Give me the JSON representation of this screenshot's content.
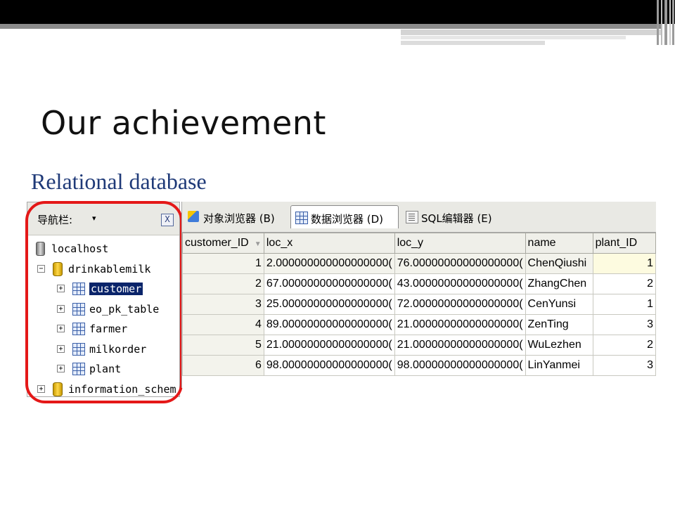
{
  "slide": {
    "title": "Our achievement",
    "subtitle": "Relational database"
  },
  "nav_panel": {
    "header_label": "导航栏:",
    "dropdown_glyph": "▾",
    "close_glyph": "X",
    "tree": [
      {
        "label": "localhost",
        "level": 0,
        "icon": "server-icon",
        "expander": ""
      },
      {
        "label": "drinkablemilk",
        "level": 1,
        "icon": "database-icon",
        "expander": "−"
      },
      {
        "label": "customer",
        "level": 2,
        "icon": "table-icon",
        "expander": "+",
        "selected": true
      },
      {
        "label": "eo_pk_table",
        "level": 2,
        "icon": "table-icon",
        "expander": "+"
      },
      {
        "label": "farmer",
        "level": 2,
        "icon": "table-icon",
        "expander": "+"
      },
      {
        "label": "milkorder",
        "level": 2,
        "icon": "table-icon",
        "expander": "+"
      },
      {
        "label": "plant",
        "level": 2,
        "icon": "table-icon",
        "expander": "+"
      },
      {
        "label": "information_schem",
        "level": 1,
        "icon": "database-icon",
        "expander": "+"
      }
    ]
  },
  "browser": {
    "tabs": [
      {
        "label": "对象浏览器 (B)",
        "icon": "object-browser-icon",
        "active": false
      },
      {
        "label": "数据浏览器 (D)",
        "icon": "data-browser-icon",
        "active": true
      },
      {
        "label": "SQL编辑器 (E)",
        "icon": "sql-editor-icon",
        "active": false
      }
    ],
    "columns": [
      "customer_ID",
      "loc_x",
      "loc_y",
      "name",
      "plant_ID"
    ],
    "sort_glyph": "▼",
    "rows": [
      [
        "1",
        "2.000000000000000000(",
        "76.00000000000000000(",
        "ChenQiushi",
        "1"
      ],
      [
        "2",
        "67.00000000000000000(",
        "43.00000000000000000(",
        "ZhangChen",
        "2"
      ],
      [
        "3",
        "25.00000000000000000(",
        "72.00000000000000000(",
        "CenYunsi",
        "1"
      ],
      [
        "4",
        "89.00000000000000000(",
        "21.00000000000000000(",
        "ZenTing",
        "3"
      ],
      [
        "5",
        "21.00000000000000000(",
        "21.00000000000000000(",
        "WuLezhen",
        "2"
      ],
      [
        "6",
        "98.00000000000000000(",
        "98.00000000000000000(",
        "LinYanmei",
        "3"
      ]
    ]
  },
  "colors": {
    "highlight": "#e41818",
    "subtitle": "#1f3a78",
    "selection": "#0a246a"
  }
}
